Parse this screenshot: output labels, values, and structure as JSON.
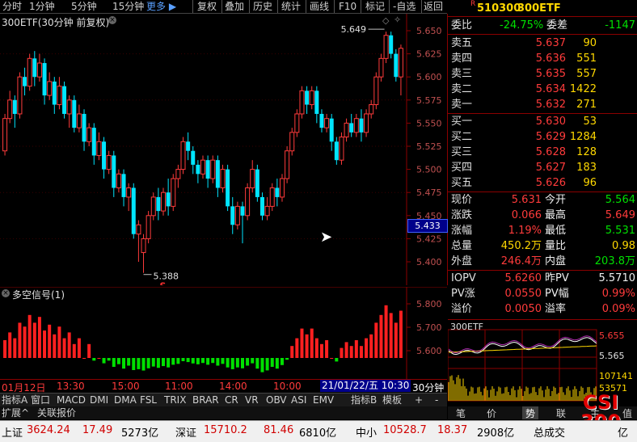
{
  "toolbar": {
    "periods": [
      "分时",
      "1分钟",
      "5分钟",
      "15分钟"
    ],
    "more": "更多",
    "actions": [
      "复权",
      "叠加",
      "历史",
      "统计",
      "画线",
      "F10",
      "标记",
      "-自选",
      "返回"
    ]
  },
  "main_chart": {
    "title": "300ETF(30分钟 前复权)",
    "high_label": "5.649",
    "low_label": "5.388",
    "s_marker": "S",
    "current_price_tag": "5.433",
    "y_ticks": [
      "5.650",
      "5.625",
      "5.600",
      "5.575",
      "5.550",
      "5.525",
      "5.500",
      "5.475",
      "5.450",
      "5.425",
      "5.400"
    ]
  },
  "sub_chart": {
    "title": "多空信号(1)",
    "y_ticks": [
      "5.800",
      "5.700",
      "5.600"
    ]
  },
  "time_axis": {
    "labels": [
      "01月12日",
      "13:30",
      "15:00",
      "11:00",
      "14:00",
      "10:00"
    ],
    "cursor_date": "21/01/22/五 10:30",
    "period": "30分钟"
  },
  "tabs": [
    "指标A",
    "窗口",
    "MACD",
    "DMI",
    "DMA",
    "FSL",
    "TRIX",
    "BRAR",
    "CR",
    "VR",
    "OBV",
    "ASI",
    "EMV",
    "指标B",
    "模板",
    "+",
    "-"
  ],
  "ext_tabs": [
    "扩展^",
    "关联报价"
  ],
  "quote": {
    "code": "510300",
    "name": "300ETF",
    "r_flag": "R",
    "weibi_label": "委比",
    "weibi": "-24.75%",
    "weicha_label": "委差",
    "weicha": "-1147",
    "asks": [
      {
        "label": "卖五",
        "price": "5.637",
        "vol": "90"
      },
      {
        "label": "卖四",
        "price": "5.636",
        "vol": "551"
      },
      {
        "label": "卖三",
        "price": "5.635",
        "vol": "557"
      },
      {
        "label": "卖二",
        "price": "5.634",
        "vol": "1422"
      },
      {
        "label": "卖一",
        "price": "5.632",
        "vol": "271"
      }
    ],
    "bids": [
      {
        "label": "买一",
        "price": "5.630",
        "vol": "53"
      },
      {
        "label": "买二",
        "price": "5.629",
        "vol": "1284"
      },
      {
        "label": "买三",
        "price": "5.628",
        "vol": "128"
      },
      {
        "label": "买四",
        "price": "5.627",
        "vol": "183"
      },
      {
        "label": "买五",
        "price": "5.626",
        "vol": "96"
      }
    ],
    "stats": [
      {
        "l1": "现价",
        "v1": "5.631",
        "l2": "今开",
        "v2": "5.564"
      },
      {
        "l1": "涨跌",
        "v1": "0.066",
        "l2": "最高",
        "v2": "5.649"
      },
      {
        "l1": "涨幅",
        "v1": "1.19%",
        "l2": "最低",
        "v2": "5.531"
      },
      {
        "l1": "总量",
        "v1": "450.2万",
        "l2": "量比",
        "v2": "0.98"
      },
      {
        "l1": "外盘",
        "v1": "246.4万",
        "l2": "内盘",
        "v2": "203.8万"
      }
    ],
    "iopv": [
      {
        "l1": "IOPV",
        "v1": "5.6260",
        "l2": "昨PV",
        "v2": "5.5710"
      },
      {
        "l1": "PV涨",
        "v1": "0.0550",
        "l2": "PV幅",
        "v2": "0.99%"
      },
      {
        "l1": "溢价",
        "v1": "0.0050",
        "l2": "溢率",
        "v2": "0.09%"
      }
    ]
  },
  "mini_chart": {
    "title": "300ETF",
    "high": "5.655",
    "low": "5.565",
    "vol_high": "107141",
    "vol_low": "53571"
  },
  "rp_tabs": [
    "笔",
    "价",
    "势",
    "联",
    "主",
    "值"
  ],
  "watermark": "CSI 300",
  "statusbar": {
    "sh_label": "上证",
    "sh_val": "3624.24",
    "sh_chg": "17.49",
    "sh_amt": "5273亿",
    "sz_label": "深证",
    "sz_val": "15710.2",
    "sz_chg": "81.46",
    "sz_amt": "6810亿",
    "zx_label": "中小",
    "zx_val": "10528.7",
    "zx_chg": "18.37",
    "zx_amt": "2908亿",
    "total_label": "总成交",
    "total_val": "",
    "last_char": "亿"
  },
  "colors": {
    "up": "#ff3b3b",
    "down": "#00e5ff",
    "signal_up": "#ff2020",
    "signal_down": "#00e000",
    "axis": "#8b0000"
  }
}
